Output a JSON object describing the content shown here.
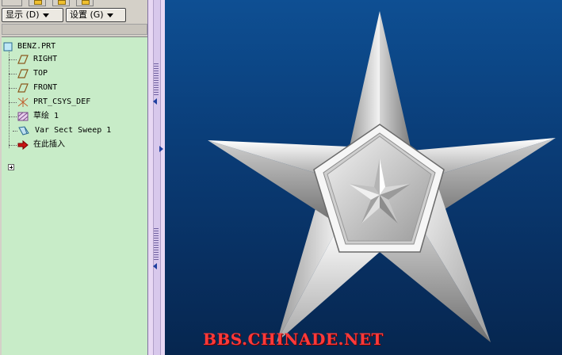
{
  "toolbar": {
    "show_label": "显示 (D)",
    "settings_label": "设置 (G)"
  },
  "tree": {
    "root": "BENZ.PRT",
    "items": [
      {
        "label": "RIGHT",
        "icon": "datum-plane-icon"
      },
      {
        "label": "TOP",
        "icon": "datum-plane-icon"
      },
      {
        "label": "FRONT",
        "icon": "datum-plane-icon"
      },
      {
        "label": "PRT_CSYS_DEF",
        "icon": "coordinate-system-icon"
      },
      {
        "label": "草绘 1",
        "icon": "sketch-icon"
      },
      {
        "label": "Var Sect Sweep 1",
        "icon": "sweep-feature-icon"
      },
      {
        "label": "在此插入",
        "icon": "insert-here-arrow-icon"
      }
    ]
  },
  "colors": {
    "tree_bg": "#c8ecc8",
    "viewport_bg": "#0a3d78",
    "watermark": "#ff3a3a"
  },
  "watermark": "BBS.CHINADE.NET"
}
